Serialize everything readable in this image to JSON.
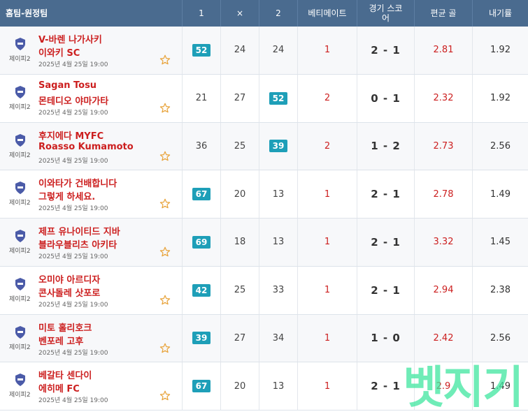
{
  "header": {
    "team": "홈팀-원정팀",
    "p1": "1",
    "px": "×",
    "p2": "2",
    "betimate": "베티메이트",
    "score": "경기 스코어",
    "avg_goal": "편균 골",
    "flow": "내기률"
  },
  "colors": {
    "header_bg": "#4a6b8f",
    "badge": "#1e9fb8",
    "team_red": "#cc1f1f",
    "watermark": "#3fe6a0"
  },
  "rows": [
    {
      "league": "제이피2",
      "home": "V-바렌 나가사키",
      "away": "이와키 SC",
      "date": "2025년 4월 25일 19:00",
      "p1": "52",
      "px": "24",
      "p2": "24",
      "highlight": "p1",
      "bet": "1",
      "score": "2 - 1",
      "avg_goal": "2.81",
      "flow": "1.92"
    },
    {
      "league": "제이피2",
      "home": "Sagan Tosu",
      "away": "몬테디오 야마가타",
      "date": "2025년 4월 25일 19:00",
      "p1": "21",
      "px": "27",
      "p2": "52",
      "highlight": "p2",
      "bet": "2",
      "score": "0 - 1",
      "avg_goal": "2.32",
      "flow": "1.92"
    },
    {
      "league": "제이피2",
      "home": "후지에다 MYFC",
      "away": "Roasso Kumamoto",
      "date": "2025년 4월 25일 19:00",
      "p1": "36",
      "px": "25",
      "p2": "39",
      "highlight": "p2",
      "bet": "2",
      "score": "1 - 2",
      "avg_goal": "2.73",
      "flow": "2.56"
    },
    {
      "league": "제이피2",
      "home": "이와타가 건배합니다",
      "away": "그렇게 하세요.",
      "date": "2025년 4월 25일 19:00",
      "p1": "67",
      "px": "20",
      "p2": "13",
      "highlight": "p1",
      "bet": "1",
      "score": "2 - 1",
      "avg_goal": "2.78",
      "flow": "1.49"
    },
    {
      "league": "제이피2",
      "home": "제프 유나이티드 지바",
      "away": "블라우블리츠 아키타",
      "date": "2025년 4월 25일 19:00",
      "p1": "69",
      "px": "18",
      "p2": "13",
      "highlight": "p1",
      "bet": "1",
      "score": "2 - 1",
      "avg_goal": "3.32",
      "flow": "1.45"
    },
    {
      "league": "제이피2",
      "home": "오미야 아르디자",
      "away": "콘사돌레 삿포로",
      "date": "2025년 4월 25일 19:00",
      "p1": "42",
      "px": "25",
      "p2": "33",
      "highlight": "p1",
      "bet": "1",
      "score": "2 - 1",
      "avg_goal": "2.94",
      "flow": "2.38"
    },
    {
      "league": "제이피2",
      "home": "미토 홀리호크",
      "away": "벤포레 고후",
      "date": "2025년 4월 25일 19:00",
      "p1": "39",
      "px": "27",
      "p2": "34",
      "highlight": "p1",
      "bet": "1",
      "score": "1 - 0",
      "avg_goal": "2.42",
      "flow": "2.56"
    },
    {
      "league": "제이피2",
      "home": "베갈타 센다이",
      "away": "에히메 FC",
      "date": "2025년 4월 25일 19:00",
      "p1": "67",
      "px": "20",
      "p2": "13",
      "highlight": "p1",
      "bet": "1",
      "score": "2 - 1",
      "avg_goal": "2.9",
      "flow": "1.49"
    }
  ],
  "watermark": "벳지기"
}
